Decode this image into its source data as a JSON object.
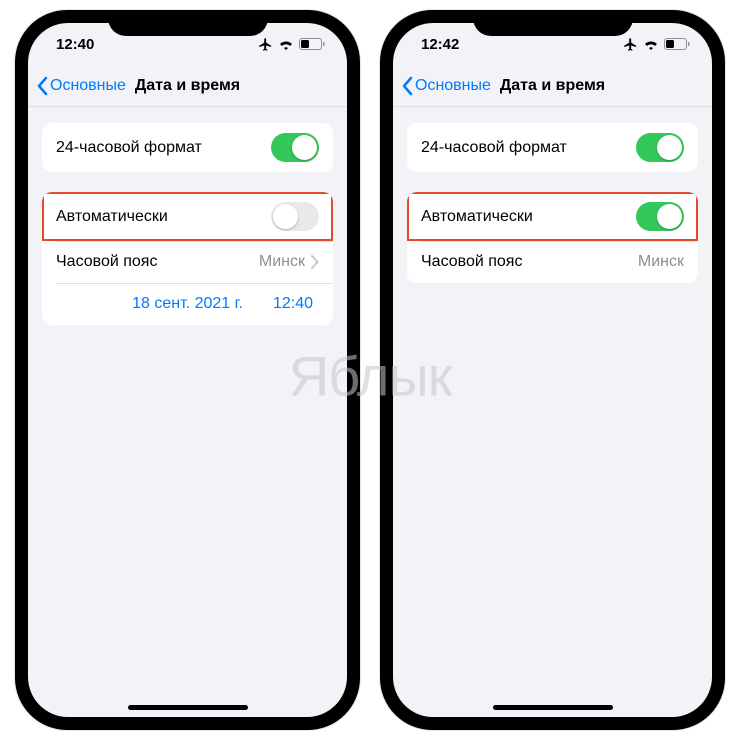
{
  "watermark": "Яблык",
  "left": {
    "status_time": "12:40",
    "back_label": "Основные",
    "title": "Дата и время",
    "row_24h": "24-часовой формат",
    "row_auto": "Автоматически",
    "row_tz_label": "Часовой пояс",
    "row_tz_value": "Минск",
    "date_value": "18 сент. 2021 г.",
    "time_value": "12:40",
    "toggle_24h_on": true,
    "toggle_auto_on": false
  },
  "right": {
    "status_time": "12:42",
    "back_label": "Основные",
    "title": "Дата и время",
    "row_24h": "24-часовой формат",
    "row_auto": "Автоматически",
    "row_tz_label": "Часовой пояс",
    "row_tz_value": "Минск",
    "toggle_24h_on": true,
    "toggle_auto_on": true
  }
}
